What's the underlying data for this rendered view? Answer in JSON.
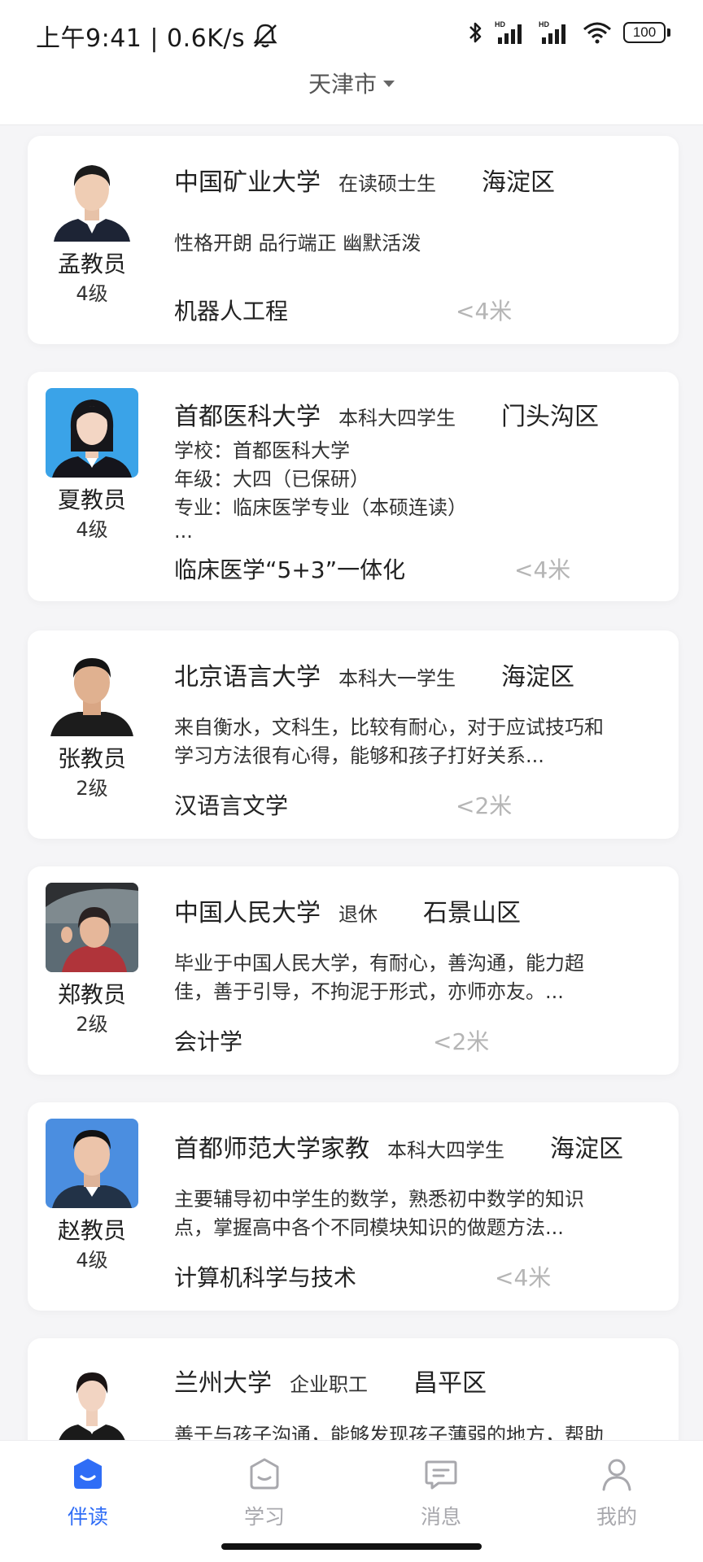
{
  "status_bar": {
    "time_speed": "上午9:41 | 0.6K/s",
    "battery": "100"
  },
  "header": {
    "city": "天津市"
  },
  "teachers": [
    {
      "name": "孟教员",
      "level": "4级",
      "school": "中国矿业大学",
      "status": "在读硕士生",
      "district": "海淀区",
      "description": "性格开朗 品行端正 幽默活泼",
      "major": "机器人工程",
      "distance": "<4米"
    },
    {
      "name": "夏教员",
      "level": "4级",
      "school": "首都医科大学",
      "status": "本科大四学生",
      "district": "门头沟区",
      "description_lines": [
        "学校：首都医科大学",
        "年级：大四（已保研）",
        "专业：临床医学专业（本硕连读）",
        "..."
      ],
      "major": "临床医学“5+3”一体化",
      "distance": "<4米"
    },
    {
      "name": "张教员",
      "level": "2级",
      "school": "北京语言大学",
      "status": "本科大一学生",
      "district": "海淀区",
      "description_lines": [
        "来自衡水，文科生，比较有耐心，对于应试技巧和",
        "学习方法很有心得，能够和孩子打好关系..."
      ],
      "major": "汉语言文学",
      "distance": "<2米"
    },
    {
      "name": "郑教员",
      "level": "2级",
      "school": "中国人民大学",
      "status": "退休",
      "district": "石景山区",
      "description_lines": [
        "毕业于中国人民大学，有耐心，善沟通，能力超",
        "佳，善于引导，不拘泥于形式，亦师亦友。..."
      ],
      "major": "会计学",
      "distance": "<2米"
    },
    {
      "name": "赵教员",
      "level": "4级",
      "school": "首都师范大学家教",
      "status": "本科大四学生",
      "district": "海淀区",
      "description_lines": [
        "主要辅导初中学生的数学，熟悉初中数学的知识",
        "点，掌握高中各个不同模块知识的做题方法..."
      ],
      "major": "计算机科学与技术",
      "distance": "<4米"
    },
    {
      "school": "兰州大学",
      "status": "企业职工",
      "district": "昌平区",
      "description": "善于与孩子沟通，能够发现孩子薄弱的地方，帮助"
    }
  ],
  "tab_bar": {
    "tabs": [
      {
        "label": "伴读",
        "icon": "companion-read-icon"
      },
      {
        "label": "学习",
        "icon": "study-icon"
      },
      {
        "label": "消息",
        "icon": "message-icon"
      },
      {
        "label": "我的",
        "icon": "profile-icon"
      }
    ],
    "active_color": "#2f6df6",
    "inactive_color": "#a8a8ad"
  }
}
